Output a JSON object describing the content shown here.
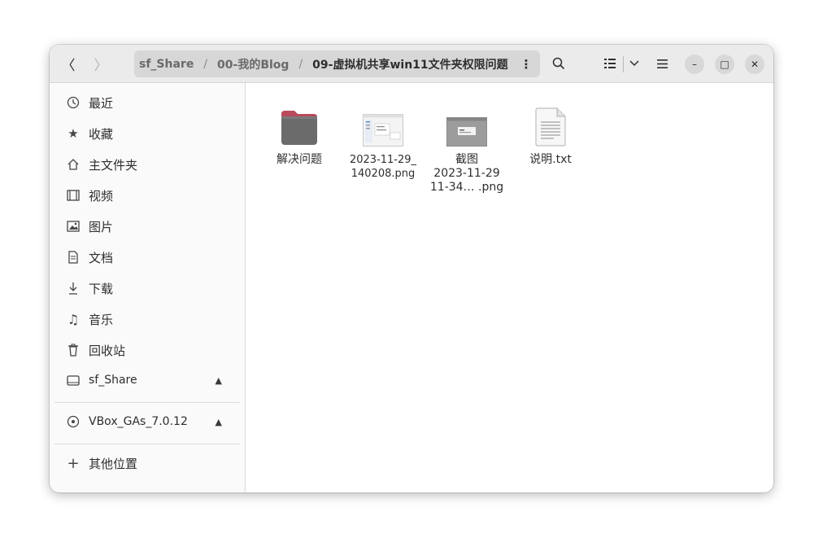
{
  "nav": {
    "back_icon": "chevron-left",
    "forward_icon": "chevron-right"
  },
  "path": {
    "crumbs": [
      "sf_Share",
      "00-我的Blog",
      "09-虚拟机共享win11文件夹权限问题"
    ],
    "separator": "/"
  },
  "toolbar": {
    "icons": [
      "search-icon",
      "list-view-icon",
      "view-options-chevron-icon",
      "hamburger-menu-icon"
    ]
  },
  "window_controls": {
    "minimize": "–",
    "maximize": "□",
    "close": "✕"
  },
  "sidebar": {
    "items": [
      {
        "label": "最近",
        "icon": "clock-icon"
      },
      {
        "label": "收藏",
        "icon": "star-icon"
      },
      {
        "label": "主文件夹",
        "icon": "home-icon"
      },
      {
        "label": "视频",
        "icon": "film-icon"
      },
      {
        "label": "图片",
        "icon": "image-icon"
      },
      {
        "label": "文档",
        "icon": "document-icon"
      },
      {
        "label": "下载",
        "icon": "download-icon"
      },
      {
        "label": "音乐",
        "icon": "music-icon"
      },
      {
        "label": "回收站",
        "icon": "trash-icon"
      }
    ],
    "drives": [
      {
        "label": "sf_Share",
        "icon": "drive-icon",
        "eject": "▲"
      },
      {
        "label": "VBox_GAs_7.0.12",
        "icon": "disc-icon",
        "eject": "▲"
      }
    ],
    "other": {
      "label": "其他位置",
      "icon": "plus-icon"
    }
  },
  "files": [
    {
      "name": "解决问题",
      "type": "folder"
    },
    {
      "name": "2023-11-29_\n140208.png",
      "type": "image"
    },
    {
      "name": "截图\n2023-11-29\n11-34… .png",
      "type": "image"
    },
    {
      "name": "说明.txt",
      "type": "text"
    }
  ],
  "colors": {
    "folder_top": "#b84a5c",
    "folder_body": "#6b6b6b",
    "headerbar": "#ebebeb",
    "sidebar": "#fafafa"
  }
}
